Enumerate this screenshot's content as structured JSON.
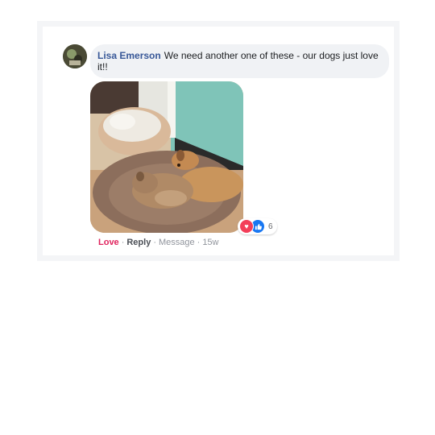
{
  "comment": {
    "author": "Lisa Emerson",
    "text": "We need another one of these - our dogs just love it!!",
    "reaction_count": "6",
    "actions": {
      "love": "Love",
      "reply": "Reply",
      "message": "Message",
      "time": "15w"
    },
    "reaction_icons": [
      "love-reaction-icon",
      "like-reaction-icon"
    ]
  },
  "colors": {
    "author": "#385898",
    "love": "#e0245e",
    "like": "#1877f2",
    "bubble": "#f0f2f5"
  }
}
